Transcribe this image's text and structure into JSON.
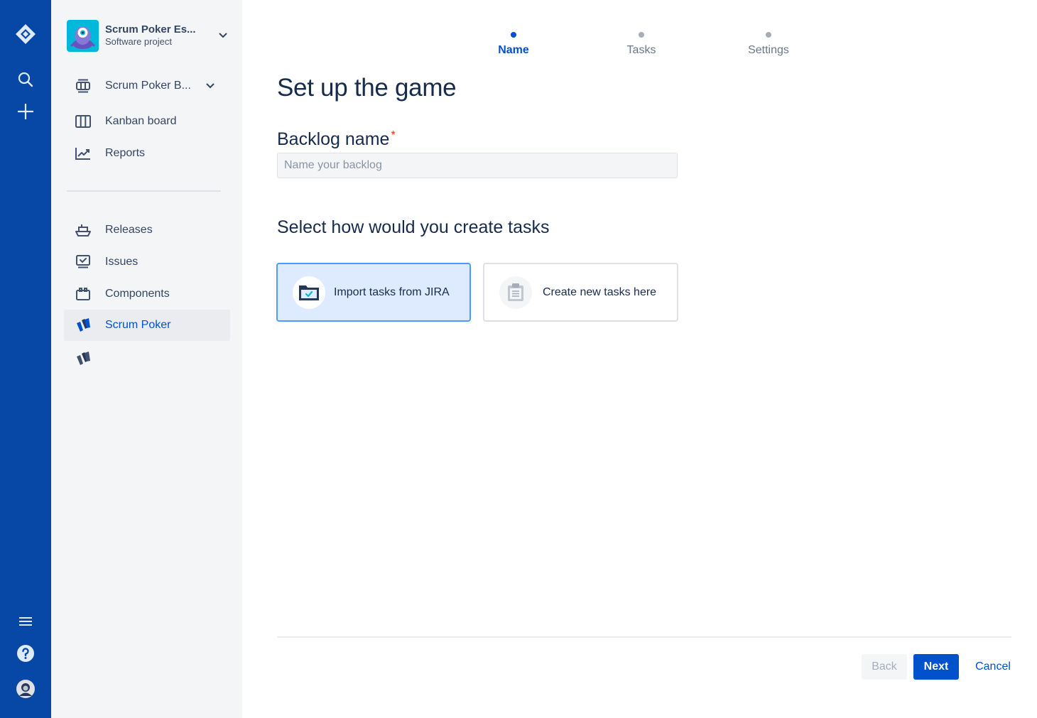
{
  "global_nav": {
    "items": [
      "jira-logo-icon",
      "search-icon",
      "create-icon",
      "menu-icon",
      "help-icon",
      "avatar"
    ]
  },
  "sidebar": {
    "project_name": "Scrum Poker Es...",
    "project_type": "Software project",
    "items": [
      {
        "label": "Scrum Poker B...",
        "icon": "board-icon"
      },
      {
        "label": "Kanban board",
        "icon": "kanban-icon"
      },
      {
        "label": "Reports",
        "icon": "reports-icon"
      },
      {
        "label": "Releases",
        "icon": "releases-icon"
      },
      {
        "label": "Issues",
        "icon": "issues-icon"
      },
      {
        "label": "Components",
        "icon": "components-icon"
      },
      {
        "label": "Scrum Poker",
        "icon": "scrum-poker-icon",
        "active": true
      },
      {
        "label": "",
        "icon": "scrum-poker-icon"
      }
    ]
  },
  "wizard": {
    "steps": [
      {
        "label": "Name",
        "active": true
      },
      {
        "label": "Tasks",
        "active": false
      },
      {
        "label": "Settings",
        "active": false
      }
    ],
    "title": "Set up the game",
    "backlog_label": "Backlog name",
    "required_mark": "*",
    "backlog_placeholder": "Name your backlog",
    "backlog_value": "",
    "section_title": "Select how would you create tasks",
    "options": [
      {
        "label": "Import tasks from JIRA",
        "icon": "folder-check-icon",
        "selected": true
      },
      {
        "label": "Create new tasks here",
        "icon": "clipboard-list-icon",
        "selected": false
      }
    ]
  },
  "footer": {
    "back_label": "Back",
    "next_label": "Next",
    "cancel_label": "Cancel"
  },
  "colors": {
    "global_nav": "#0747A6",
    "sidebar_bg": "#F4F5F7",
    "primary": "#0052CC",
    "selected_card_bg": "#DEEBFF",
    "selected_card_border": "#4C9AFF",
    "required": "#DE350B"
  }
}
